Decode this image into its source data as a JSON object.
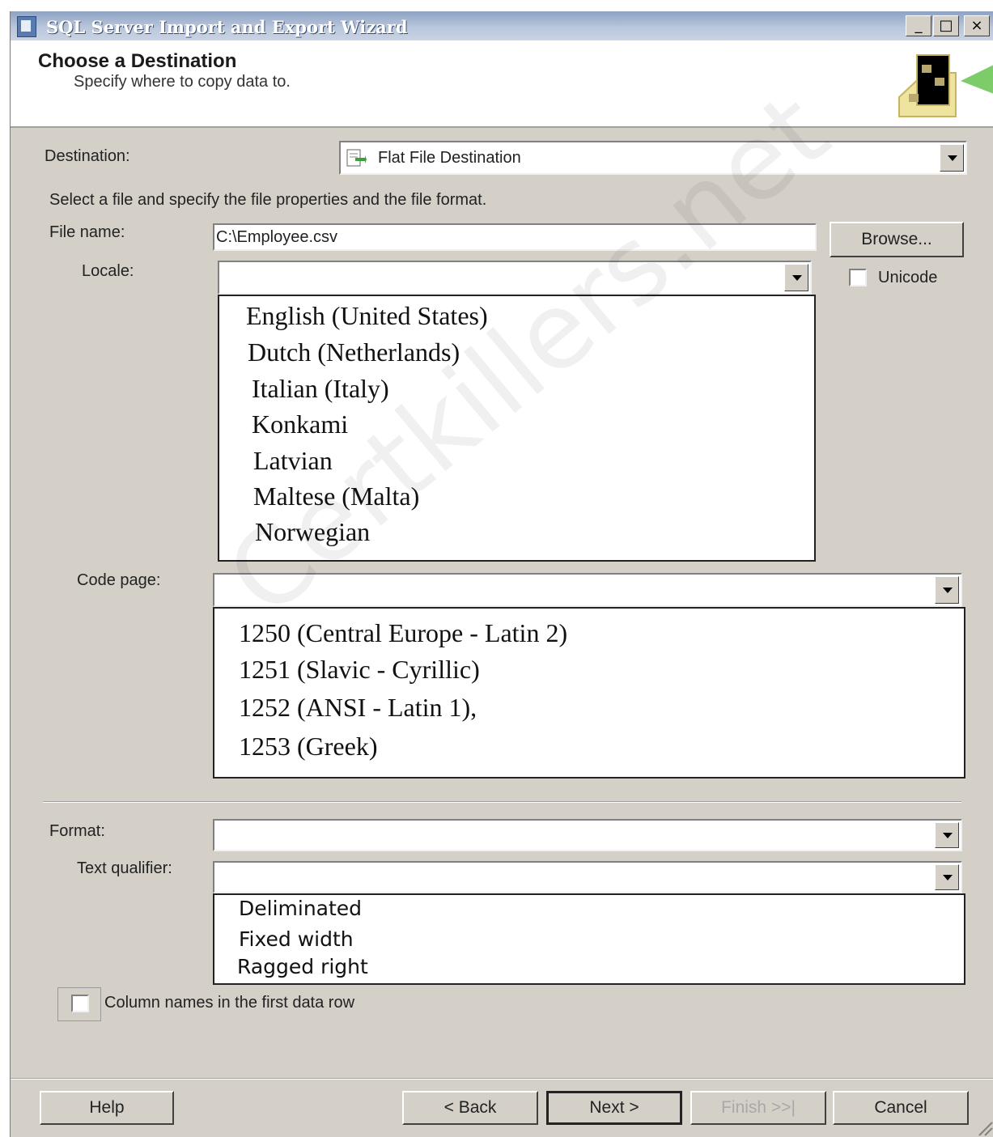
{
  "window": {
    "title": "SQL Server Import and Export Wizard",
    "minimize_glyph": "_",
    "maximize_glyph": "□",
    "close_glyph": "×"
  },
  "header": {
    "title": "Choose a Destination",
    "subtitle": "Specify where to copy data to.",
    "graphic_icon": "wizard-folder-arrow-icon"
  },
  "destination": {
    "label": "Destination:",
    "value": "Flat File Destination",
    "icon": "flat-file-icon"
  },
  "instruction": "Select a file and specify the file properties and the file format.",
  "file_name": {
    "label": "File name:",
    "value": "C:\\Employee.csv",
    "browse_label": "Browse..."
  },
  "locale": {
    "label": "Locale:",
    "value": "",
    "options": [
      "English (United States)",
      "Dutch (Netherlands)",
      "Italian (Italy)",
      "Konkami",
      "Latvian",
      "Maltese (Malta)",
      "Norwegian"
    ]
  },
  "unicode": {
    "label": "Unicode",
    "checked": false
  },
  "code_page": {
    "label": "Code page:",
    "value": "",
    "options": [
      "1250 (Central Europe - Latin 2)",
      "1251 (Slavic - Cyrillic)",
      "1252 (ANSI - Latin 1),",
      "1253 (Greek)"
    ]
  },
  "format": {
    "label": "Format:",
    "value": "",
    "options": [
      "Deliminated",
      "Fixed width",
      "Ragged right"
    ]
  },
  "text_qualifier": {
    "label": "Text qualifier:",
    "value": ""
  },
  "column_names": {
    "label": "Column names in the first data row",
    "checked": false
  },
  "watermark": "Certkillers.net",
  "buttons": {
    "help": "Help",
    "back": "< Back",
    "next": "Next >",
    "finish": "Finish >>|",
    "cancel": "Cancel"
  },
  "colors": {
    "dialog_bg": "#d4d0c8",
    "titlebar": "#8da2c4",
    "disabled_text": "#a8a8a8"
  }
}
